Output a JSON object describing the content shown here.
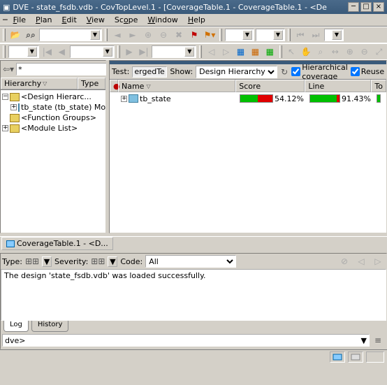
{
  "title": "DVE - state_fsdb.vdb -  CovTopLevel.1 - [CoverageTable.1 - CoverageTable.1 - <De",
  "menu": {
    "file": "File",
    "plan": "Plan",
    "edit": "Edit",
    "view": "View",
    "scope": "Scope",
    "window": "Window",
    "help": "Help"
  },
  "leftbar": {
    "filter": "*"
  },
  "treehdr": {
    "c1": "Hierarchy",
    "c2": "Type"
  },
  "tree": {
    "n1": "<Design Hierarc...",
    "n2": "tb_state (tb_state) Module",
    "n3": "<Function Groups>",
    "n4": "<Module List>"
  },
  "covtop": {
    "test_lbl": "Test:",
    "test_val": "ergedTest",
    "show_lbl": "Show:",
    "show_sel": "Design Hierarchy",
    "hier": "Hierarchical coverage",
    "reuse": "Reuse"
  },
  "covhdr": {
    "name": "Name",
    "score": "Score",
    "line": "Line",
    "tog": "To"
  },
  "covrow": {
    "name": "tb_state",
    "score": "54.12%",
    "line": "91.43%"
  },
  "tab": {
    "label": "CoverageTable.1 - <D..."
  },
  "cons": {
    "type": "Type:",
    "sev": "Severity:",
    "code": "Code:",
    "code_sel": "All",
    "msg": "The design 'state_fsdb.vdb' was loaded successfully."
  },
  "btabs": {
    "log": "Log",
    "hist": "History"
  },
  "prompt": {
    "p": "dve>"
  },
  "status": {
    "coord": ""
  }
}
